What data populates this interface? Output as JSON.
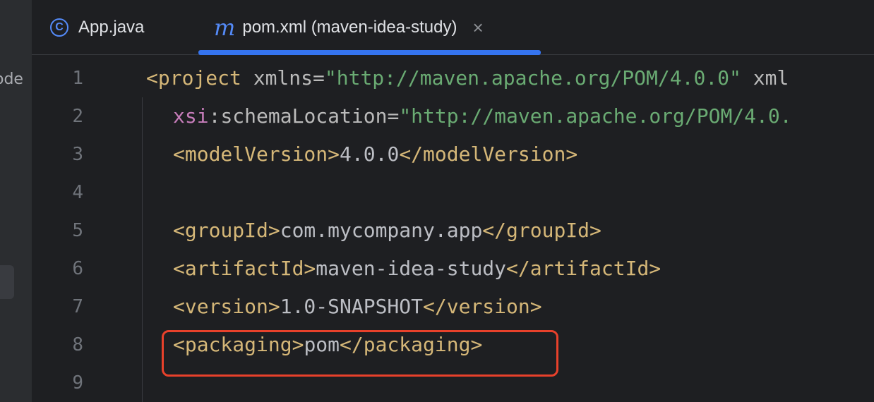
{
  "side_panel": {
    "partial_label": "ode"
  },
  "tabs": [
    {
      "label": "App.java",
      "icon": "java-class-icon",
      "active": false
    },
    {
      "label": "pom.xml (maven-idea-study)",
      "icon": "maven-icon",
      "active": true,
      "close_glyph": "×"
    }
  ],
  "icons": {
    "java_class_glyph": "C",
    "maven_glyph": "m"
  },
  "line_numbers": [
    "1",
    "2",
    "3",
    "4",
    "5",
    "6",
    "7",
    "8",
    "9"
  ],
  "code": {
    "line1": {
      "open": "<project",
      "attr": "xmlns",
      "eq": "=",
      "value": "\"http://maven.apache.org/POM/4.0.0\"",
      "rest": "xml"
    },
    "line2": {
      "ns": "xsi",
      "sep": ":",
      "attr": "schemaLocation",
      "eq": "=",
      "value": "\"http://maven.apache.org/POM/4.0."
    },
    "line3": {
      "open": "<modelVersion>",
      "text": "4.0.0",
      "close": "</modelVersion>"
    },
    "line4": {},
    "line5": {
      "open": "<groupId>",
      "text": "com.mycompany.app",
      "close": "</groupId>"
    },
    "line6": {
      "open": "<artifactId>",
      "text": "maven-idea-study",
      "close": "</artifactId>"
    },
    "line7": {
      "open": "<version>",
      "text": "1.0-SNAPSHOT",
      "close": "</version>"
    },
    "line8": {
      "open": "<packaging>",
      "text": "pom",
      "close": "</packaging>"
    },
    "line9": {}
  },
  "colors": {
    "accent": "#3574f0",
    "tag": "#d5b778",
    "string": "#6aab73",
    "namespace": "#c77dbb",
    "highlight_box": "#e8412b",
    "background": "#1e1f22"
  }
}
